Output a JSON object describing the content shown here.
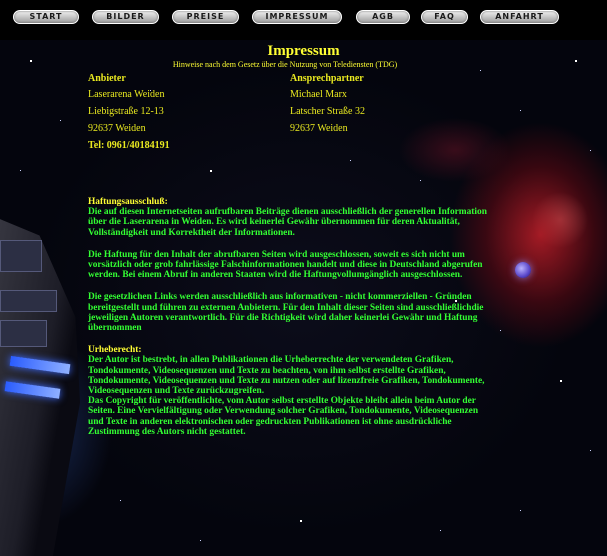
{
  "nav": {
    "items": [
      "START",
      "BILDER",
      "PREISE",
      "IMPRESSUM",
      "AGB",
      "FAQ",
      "ANFAHRT"
    ]
  },
  "page": {
    "title": "Impressum",
    "subtitle": "Hinweise nach dem Gesetz über die Nutzung von Telediensten (TDG)"
  },
  "anbieter": {
    "heading": "Anbieter",
    "name": "Laserarena Weiden",
    "street": "Liebigstraße 12-13",
    "city": "92637 Weiden",
    "tel": "Tel: 0961/40184191"
  },
  "ansprechpartner": {
    "heading": "Ansprechpartner",
    "name": "Michael Marx",
    "street": "Latscher Straße 32",
    "city": "92637 Weiden"
  },
  "haftung": {
    "heading": "Haftungsausschluß:",
    "p1": "Die auf diesen Internetseiten aufrufbaren Beiträge dienen ausschließlich der generellen Information über die Laserarena in Weiden. Es wird keinerlei Gewähr übernommen für deren Aktualität, Vollständigkeit und Korrektheit der Informationen.",
    "p2": "Die Haftung für den Inhalt der abrufbaren Seiten wird ausgeschlossen, soweit es sich nicht um vorsätzlich oder grob fahrlässige Falschinformationen handelt und diese in Deutschland abgerufen werden. Bei einem Abruf in anderen Staaten wird die Haftungvollumgänglich ausgeschlossen.",
    "p3": "Die gesetzlichen Links werden ausschließlich aus informativen - nicht kommerziellen - Gründen bereitgestellt und führen zu externen Anbietern. Für den Inhalt dieser Seiten sind ausschließlichdie jeweiligen Autoren verantwortlich. Für die Richtigkeit wird daher keinerlei Gewähr und Haftung übernommen"
  },
  "urheberrecht": {
    "heading": "Urheberecht:",
    "p1": "Der Autor ist bestrebt, in allen Publikationen die Urheberrechte der verwendeten Grafiken, Tondokumente, Videosequenzen und Texte zu beachten, von ihm selbst erstellte Grafiken, Tondokumente, Videosequenzen und Texte zu nutzen oder auf lizenzfreie Grafiken, Tondokumente, Videosequenzen und Texte zurückzugreifen.",
    "p2": "Das Copyright für veröffentlichte, vom Autor selbst erstellte Objekte bleibt allein beim Autor der Seiten. Eine Vervielfältigung oder Verwendung solcher Grafiken, Tondokumente, Videosequenzen und Texte in anderen elektronischen oder gedruckten Publikationen ist ohne ausdrückliche Zustimmung des Autors nicht gestattet."
  },
  "colors": {
    "background": "#000000",
    "heading_yellow": "#ffff33",
    "body_green": "#33ff33",
    "nebula_red": "#be1e28"
  }
}
